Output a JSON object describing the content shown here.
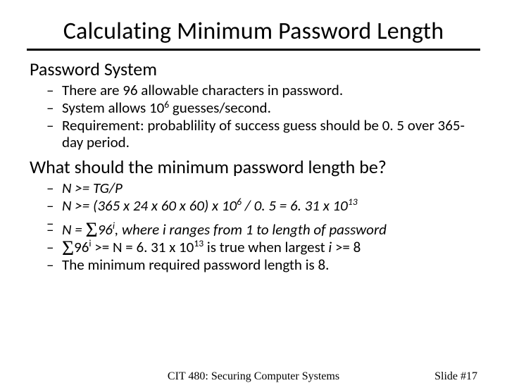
{
  "title": "Calculating Minimum Password Length",
  "section1": {
    "heading": "Password System",
    "items": [
      {
        "text": "There are 96 allowable characters in password."
      },
      {
        "pre": "System allows 10",
        "sup": "6",
        "post": " guesses/second."
      },
      {
        "text": "Requirement: probablility of success guess should be 0. 5 over 365-day period."
      }
    ]
  },
  "section2": {
    "heading": "What should the minimum password length be?",
    "items": [
      {
        "ital_text": "N >= TG/P"
      },
      {
        "i_pre": "N >= (365 x 24 x 60 x 60) x 10",
        "i_sup1": "6",
        "i_mid": " / 0. 5 = 6. 31 x 10",
        "i_sup2": "13"
      },
      {
        "i_pre2": "N = ",
        "sigma": "Σ",
        "i_base": "96",
        "i_exp": "i",
        "i_post": ", where i ranges from 1 to length of password"
      },
      {
        "sigma2": "Σ",
        "b2": "96",
        "e2": "i",
        "mid2": " >= N = 6. 31 x 10",
        "sup2": "13",
        "post2": " is true when largest ",
        "ivar": "i",
        "tail2": " >= 8"
      },
      {
        "text": "The minimum required password length is 8."
      }
    ]
  },
  "footer": {
    "center": "CIT 480: Securing Computer Systems",
    "right": "Slide #17"
  }
}
